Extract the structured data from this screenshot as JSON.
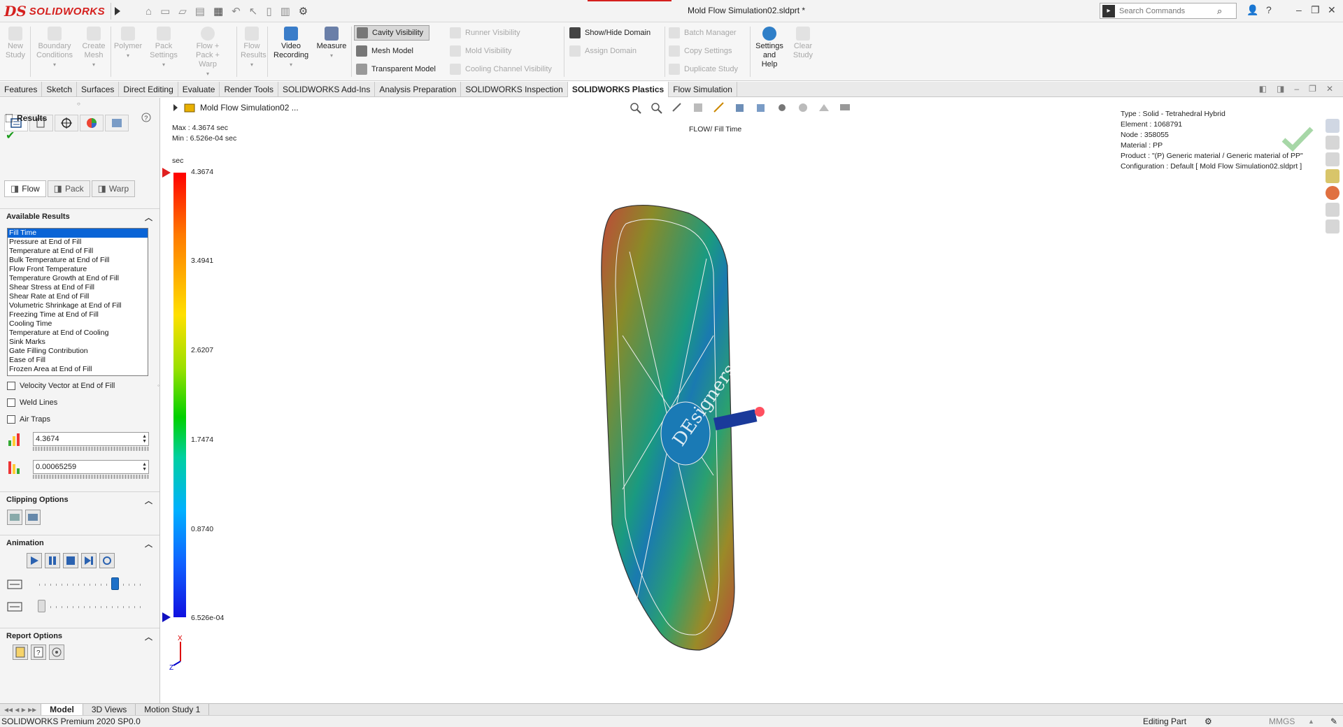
{
  "titlebar": {
    "brand": "SOLIDWORKS",
    "doc_title": "Mold Flow Simulation02.sldprt *",
    "search_placeholder": "Search Commands"
  },
  "commands": {
    "new_study": "New Study",
    "boundary_conditions": "Boundary Conditions",
    "create_mesh": "Create Mesh",
    "polymer": "Polymer",
    "pack_settings": "Pack Settings",
    "flow_pack_warp": "Flow + Pack + Warp",
    "flow_results": "Flow Results",
    "video_recording": "Video Recording",
    "measure": "Measure",
    "cavity_visibility": "Cavity Visibility",
    "mesh_model": "Mesh Model",
    "transparent_model": "Transparent Model",
    "runner_visibility": "Runner Visibility",
    "mold_visibility": "Mold Visibility",
    "cooling_channel_visibility": "Cooling Channel Visibility",
    "show_hide_domain": "Show/Hide Domain",
    "assign_domain": "Assign Domain",
    "batch_manager": "Batch Manager",
    "copy_settings": "Copy Settings",
    "duplicate_study": "Duplicate Study",
    "settings_and_help": "Settings and Help",
    "clear_study": "Clear Study"
  },
  "tabs": [
    "Features",
    "Sketch",
    "Surfaces",
    "Direct Editing",
    "Evaluate",
    "Render Tools",
    "SOLIDWORKS Add-Ins",
    "Analysis Preparation",
    "SOLIDWORKS Inspection",
    "SOLIDWORKS Plastics",
    "Flow Simulation"
  ],
  "active_tab": "SOLIDWORKS Plastics",
  "panel": {
    "title": "Results",
    "flow_tabs": [
      "Flow",
      "Pack",
      "Warp"
    ],
    "available_results_title": "Available Results",
    "results": [
      "Fill Time",
      "Pressure at End of Fill",
      "Temperature at End of Fill",
      "Bulk Temperature at End of Fill",
      "Flow Front Temperature",
      "Temperature Growth at End of Fill",
      "Shear Stress at End of Fill",
      "Shear Rate at End of Fill",
      "Volumetric Shrinkage at End of Fill",
      "Freezing Time at End of Fill",
      "Cooling Time",
      "Temperature at End of Cooling",
      "Sink Marks",
      "Gate Filling Contribution",
      "Ease of Fill",
      "Frozen Area at End of Fill"
    ],
    "selected_result": "Fill Time",
    "checkboxes": [
      "Velocity Vector at End of Fill",
      "Weld Lines",
      "Air Traps"
    ],
    "max_value": "4.3674",
    "min_value": "0.00065259",
    "clipping_title": "Clipping Options",
    "animation_title": "Animation",
    "animation_speed": 0.72,
    "animation_frame": 0.02,
    "report_title": "Report Options"
  },
  "graphics": {
    "breadcrumb": "Mold Flow Simulation02  ...",
    "max_text": "Max : 4.3674 sec",
    "min_text": "Min : 6.526e-04 sec",
    "plot_title": "FLOW/ Fill Time",
    "info": [
      "Type : Solid - Tetrahedral Hybrid",
      "Element : 1068791",
      "Node : 358055",
      "Material : PP",
      "Product :    \"(P)  Generic material / Generic material of PP\"",
      "Configuration : Default [ Mold Flow Simulation02.sldprt ]"
    ],
    "legend_unit": "sec",
    "legend_labels": [
      "4.3674",
      "3.4941",
      "2.6207",
      "1.7474",
      "0.8740",
      "6.526e-04"
    ],
    "watermark": "DEsigners",
    "triad_x": "X",
    "triad_z": "Z"
  },
  "model_tabs": [
    "Model",
    "3D Views",
    "Motion Study 1"
  ],
  "status": {
    "version": "SOLIDWORKS Premium 2020 SP0.0",
    "mode": "Editing Part",
    "units": "MMGS"
  }
}
